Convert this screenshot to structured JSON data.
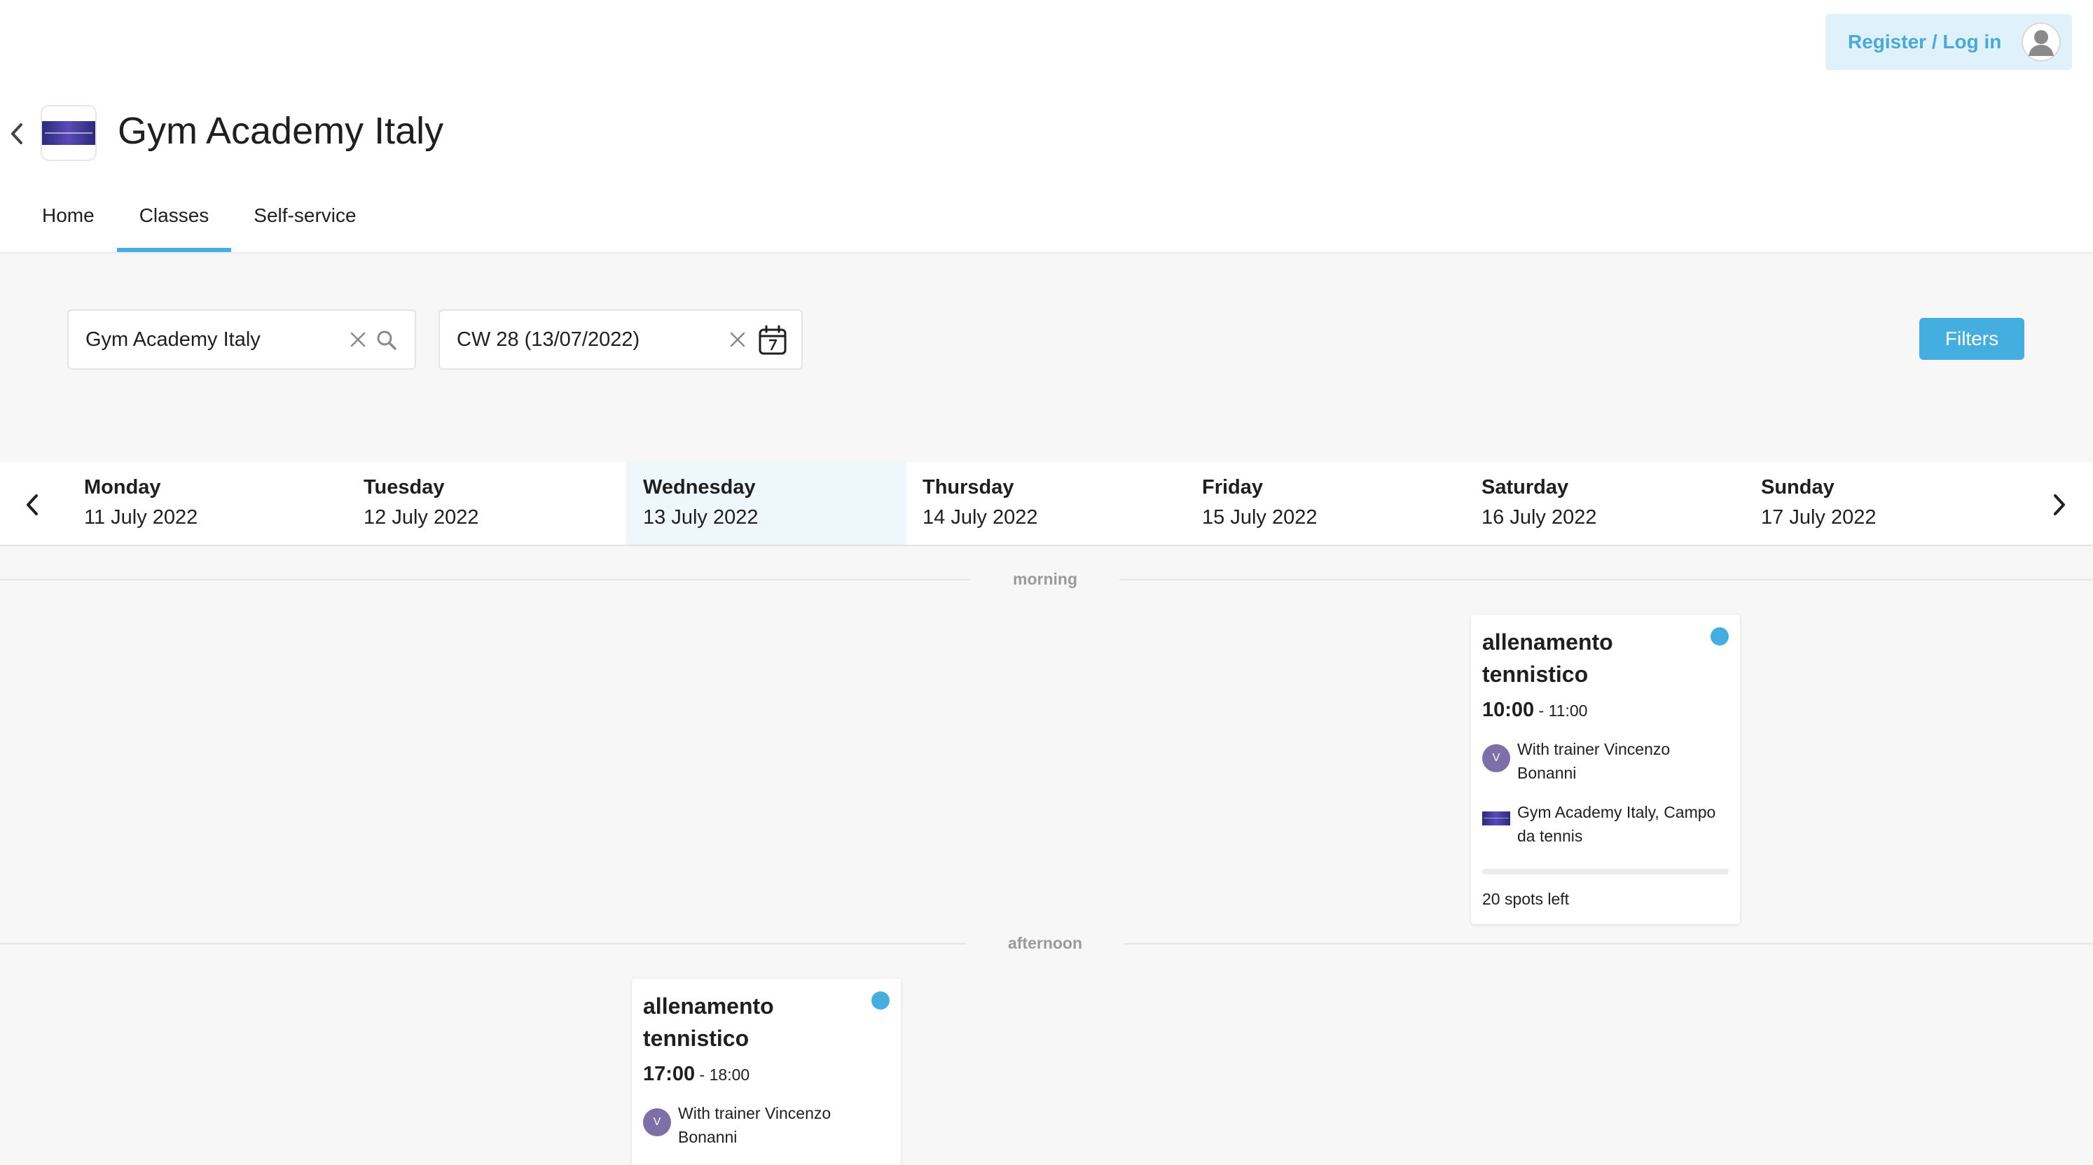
{
  "header": {
    "login_label": "Register / Log in",
    "club_title": "Gym Academy Italy"
  },
  "tabs": [
    {
      "label": "Home",
      "active": false
    },
    {
      "label": "Classes",
      "active": true
    },
    {
      "label": "Self-service",
      "active": false
    }
  ],
  "filters": {
    "location_value": "Gym Academy Italy",
    "week_value": "CW 28 (13/07/2022)",
    "filters_label": "Filters"
  },
  "days": [
    {
      "name": "Monday",
      "date": "11 July 2022",
      "active": false
    },
    {
      "name": "Tuesday",
      "date": "12 July 2022",
      "active": false
    },
    {
      "name": "Wednesday",
      "date": "13 July 2022",
      "active": true
    },
    {
      "name": "Thursday",
      "date": "14 July 2022",
      "active": false
    },
    {
      "name": "Friday",
      "date": "15 July 2022",
      "active": false
    },
    {
      "name": "Saturday",
      "date": "16 July 2022",
      "active": false
    },
    {
      "name": "Sunday",
      "date": "17 July 2022",
      "active": false
    }
  ],
  "periods": {
    "morning": "morning",
    "afternoon": "afternoon"
  },
  "classes": [
    {
      "title": "allenamento tennistico",
      "start": "10:00",
      "end": " - 11:00",
      "trainer_initial": "V",
      "trainer": "With trainer Vincenzo Bonanni",
      "location": "Gym Academy Italy, Campo da tennis",
      "spots": "20 spots left",
      "spots_fill": 0.0,
      "status_color": "#44aee0"
    },
    {
      "title": "allenamento tennistico",
      "start": "17:00",
      "end": " - 18:00",
      "trainer_initial": "V",
      "trainer": "With trainer Vincenzo Bonanni",
      "status_color": "#44aee0"
    }
  ],
  "colors": {
    "accent": "#44aee0",
    "login_bg": "#dff1fb",
    "active_day_bg": "#eef7fc"
  },
  "icons": {
    "back": "chevron-left-icon",
    "avatar": "user-avatar-icon",
    "clear": "close-icon",
    "search": "search-icon",
    "calendar": "calendar-icon",
    "prev": "chevron-left-icon",
    "next": "chevron-right-icon"
  }
}
